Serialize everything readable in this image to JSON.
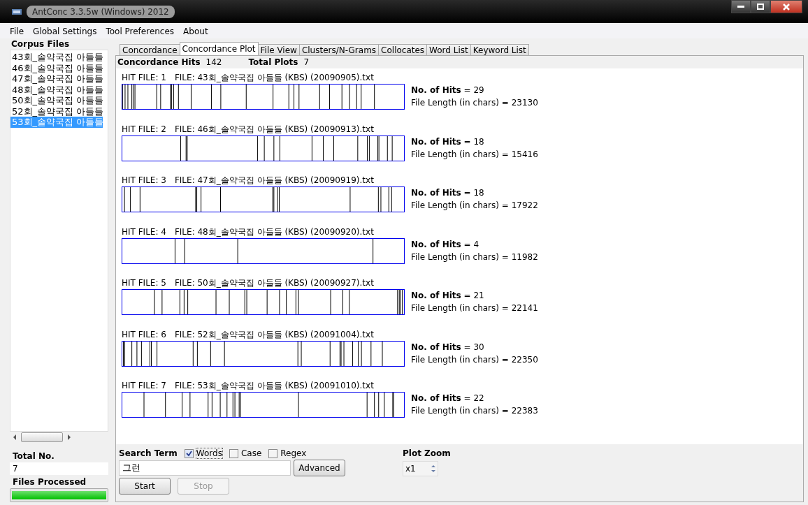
{
  "window": {
    "title": "AntConc 3.3.5w (Windows) 2012"
  },
  "menu": [
    "File",
    "Global Settings",
    "Tool Preferences",
    "About"
  ],
  "sidebar": {
    "heading": "Corpus Files",
    "files": [
      {
        "name": "43회_솔약국집 아들들",
        "selected": false
      },
      {
        "name": "46회_솔약국집 아들들",
        "selected": false
      },
      {
        "name": "47회_솔약국집 아들들",
        "selected": false
      },
      {
        "name": "48회_솔약국집 아들들",
        "selected": false
      },
      {
        "name": "50회_솔약국집 아들들",
        "selected": false
      },
      {
        "name": "52회_솔약국집 아들들",
        "selected": false
      },
      {
        "name": "53회_솔약국집 아들들",
        "selected": true
      }
    ],
    "total_label": "Total No.",
    "total_value": "7",
    "processed_label": "Files Processed",
    "progress": {
      "level": 1
    }
  },
  "tabs": [
    {
      "label": "Concordance",
      "selected": false
    },
    {
      "label": "Concordance Plot",
      "selected": true
    },
    {
      "label": "File View",
      "selected": false
    },
    {
      "label": "Clusters/N-Grams",
      "selected": false
    },
    {
      "label": "Collocates",
      "selected": false
    },
    {
      "label": "Word List",
      "selected": false
    },
    {
      "label": "Keyword List",
      "selected": false
    }
  ],
  "summary": {
    "hits_label": "Concordance Hits",
    "hits_value": "142",
    "plots_label": "Total Plots",
    "plots_value": "7"
  },
  "plots": [
    {
      "hit": "HIT FILE: 1",
      "file": "FILE: 43회_솔약국집 아들들 (KBS) (20090905).txt",
      "hits": "**No. of Hits** = 29",
      "length": "File Length (in chars) = 23130"
    },
    {
      "hit": "HIT FILE: 2",
      "file": "FILE: 46회_솔약국집 아들들 (KBS) (20090913).txt",
      "hits": "**No. of Hits** = 18",
      "length": "File Length (in chars) = 15416"
    },
    {
      "hit": "HIT FILE: 3",
      "file": "FILE: 47회_솔약국집 아들들 (KBS) (20090919).txt",
      "hits": "**No. of Hits** = 18",
      "length": "File Length (in chars) = 17922"
    },
    {
      "hit": "HIT FILE: 4",
      "file": "FILE: 48회_솔약국집 아들들 (KBS) (20090920).txt",
      "hits": "**No. of Hits** = 4",
      "length": "File Length (in chars) = 11982"
    },
    {
      "hit": "HIT FILE: 5",
      "file": "FILE: 50회_솔약국집 아들들 (KBS) (20090927).txt",
      "hits": "**No. of Hits** = 21",
      "length": "File Length (in chars) = 22141"
    },
    {
      "hit": "HIT FILE: 6",
      "file": "FILE: 52회_솔약국집 아들들 (KBS) (20091004).txt",
      "hits": "**No. of Hits** = 30",
      "length": "File Length (in chars) = 22350"
    },
    {
      "hit": "HIT FILE: 7",
      "file": "FILE: 53회_솔약국집 아들들 (KBS) (20091010).txt",
      "hits": "**No. of Hits** = 22",
      "length": "File Length (in chars) = 22383"
    }
  ],
  "search": {
    "label": "Search Term",
    "options": [
      {
        "label": "Words",
        "checked": true
      },
      {
        "label": "Case",
        "checked": false
      },
      {
        "label": "Regex",
        "checked": false
      }
    ],
    "value": "그런",
    "advanced": "Advanced",
    "start": {
      "label": "Start",
      "disabled": false
    },
    "stop": {
      "label": "Stop",
      "disabled": true
    },
    "zoom_label": "Plot Zoom",
    "zoom_value": "x1"
  }
}
